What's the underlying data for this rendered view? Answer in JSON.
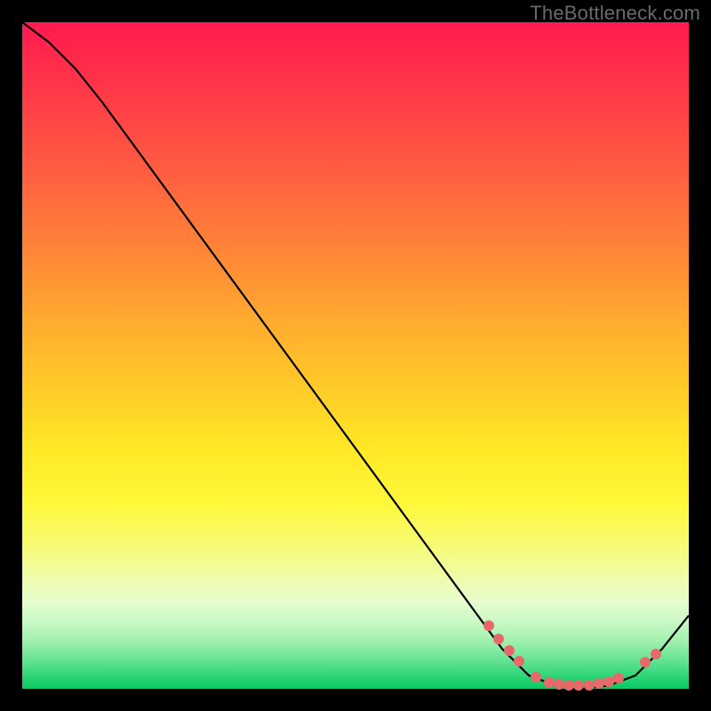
{
  "watermark": "TheBottleneck.com",
  "colors": {
    "frame_bg": "#000000",
    "watermark_text": "#6a6a6a",
    "curve_stroke": "#000000",
    "dot_fill": "#e66a6a"
  },
  "chart_data": {
    "type": "line",
    "title": "",
    "xlabel": "",
    "ylabel": "",
    "xlim": [
      0,
      100
    ],
    "ylim": [
      0,
      100
    ],
    "grid": false,
    "legend": false,
    "series": [
      {
        "name": "bottleneck-curve",
        "x": [
          0,
          4,
          8,
          12,
          72,
          76,
          80,
          84,
          88,
          92,
          96,
          100
        ],
        "y": [
          100,
          97,
          93,
          88,
          6,
          2,
          0.5,
          0,
          0.5,
          2,
          6,
          11
        ]
      }
    ],
    "highlight_points": {
      "name": "sample-dots",
      "x": [
        70,
        71.5,
        73,
        74.5,
        77,
        79,
        80.5,
        82,
        83.5,
        85,
        86.5,
        88,
        89.5,
        93.5,
        95
      ],
      "y": [
        9.5,
        7.5,
        5.8,
        4.2,
        1.8,
        1.0,
        0.7,
        0.5,
        0.5,
        0.6,
        0.8,
        1.1,
        1.6,
        4.0,
        5.2
      ]
    },
    "gradient_stops": [
      {
        "pos": 0.0,
        "color": "#ff1a4f"
      },
      {
        "pos": 0.24,
        "color": "#ff6340"
      },
      {
        "pos": 0.54,
        "color": "#ffc828"
      },
      {
        "pos": 0.72,
        "color": "#fff83a"
      },
      {
        "pos": 0.9,
        "color": "#c9f9c6"
      },
      {
        "pos": 1.0,
        "color": "#0fc765"
      }
    ]
  }
}
